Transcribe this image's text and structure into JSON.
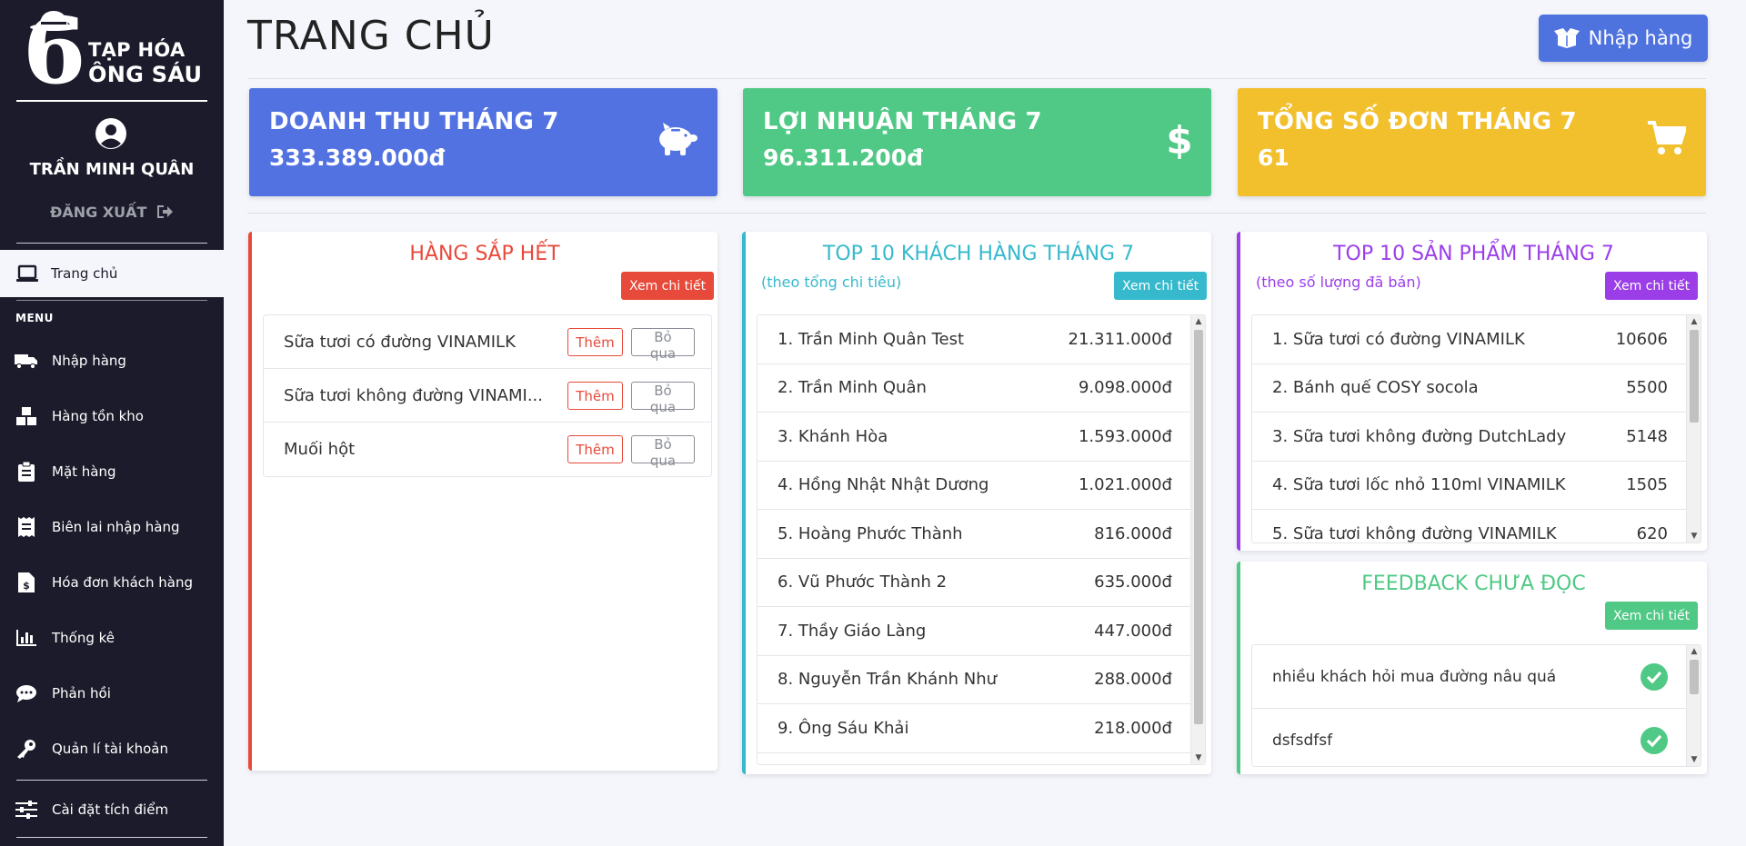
{
  "sidebar": {
    "logo": {
      "line1": "TẠP HÓA",
      "line2": "ÔNG SÁU"
    },
    "user_name": "TRẦN MINH QUÂN",
    "logout_label": "ĐĂNG XUẤT",
    "home_label": "Trang chủ",
    "menu_title": "MENU",
    "items": [
      {
        "label": "Nhập hàng",
        "icon": "truck-icon"
      },
      {
        "label": "Hàng tồn kho",
        "icon": "boxes-icon"
      },
      {
        "label": "Mặt hàng",
        "icon": "clipboard-icon"
      },
      {
        "label": "Biên lai nhập hàng",
        "icon": "receipt-icon"
      },
      {
        "label": "Hóa đơn khách hàng",
        "icon": "invoice-dollar-icon"
      },
      {
        "label": "Thống kê",
        "icon": "bar-chart-icon"
      },
      {
        "label": "Phản hồi",
        "icon": "comment-icon"
      },
      {
        "label": "Quản lí tài khoản",
        "icon": "key-icon"
      }
    ],
    "settings_label": "Cài đặt tích điểm"
  },
  "header": {
    "title": "TRANG CHỦ",
    "import_button": "Nhập hàng"
  },
  "stats": {
    "revenue": {
      "label": "DOANH THU THÁNG 7",
      "value": "333.389.000đ",
      "color": "#5272e2"
    },
    "profit": {
      "label": "LỢI NHUẬN THÁNG 7",
      "value": "96.311.200đ",
      "color": "#4fc985"
    },
    "orders": {
      "label": "TỔNG SỐ ĐƠN THÁNG 7",
      "value": "61",
      "color": "#f2bf2d"
    }
  },
  "low_stock": {
    "title": "HÀNG SẮP HẾT",
    "detail_button": "Xem chi tiết",
    "add_label": "Thêm",
    "skip_label": "Bỏ qua",
    "items": [
      "Sữa tươi có đường VINAMILK",
      "Sữa tươi không đường VINAMI...",
      "Muối hột"
    ]
  },
  "top_customers": {
    "title": "TOP 10 KHÁCH HÀNG THÁNG 7",
    "subtitle": "(theo tổng chi tiêu)",
    "detail_button": "Xem chi tiết",
    "rows": [
      {
        "name": "1. Trần Minh Quân Test",
        "value": "21.311.000đ"
      },
      {
        "name": "2. Trần Minh Quân",
        "value": "9.098.000đ"
      },
      {
        "name": "3. Khánh Hòa",
        "value": "1.593.000đ"
      },
      {
        "name": "4. Hồng Nhật Nhật Dương",
        "value": "1.021.000đ"
      },
      {
        "name": "5. Hoàng Phước Thành",
        "value": "816.000đ"
      },
      {
        "name": "6. Vũ Phước Thành 2",
        "value": "635.000đ"
      },
      {
        "name": "7. Thầy Giáo Làng",
        "value": "447.000đ"
      },
      {
        "name": "8. Nguyễn Trần Khánh Như",
        "value": "288.000đ"
      },
      {
        "name": "9. Ông Sáu Khải",
        "value": "218.000đ"
      }
    ]
  },
  "top_products": {
    "title": "TOP 10 SẢN PHẨM THÁNG 7",
    "subtitle": "(theo số lượng đã bán)",
    "detail_button": "Xem chi tiết",
    "rows": [
      {
        "name": "1. Sữa tươi có đường VINAMILK",
        "value": "10606"
      },
      {
        "name": "2. Bánh quế COSY socola",
        "value": "5500"
      },
      {
        "name": "3. Sữa tươi không đường DutchLady",
        "value": "5148"
      },
      {
        "name": "4. Sữa tươi lốc nhỏ 110ml VINAMILK",
        "value": "1505"
      },
      {
        "name": "5. Sữa tươi không đường VINAMILK",
        "value": "620"
      }
    ]
  },
  "feedback": {
    "title": "FEEDBACK CHƯA ĐỌC",
    "detail_button": "Xem chi tiết",
    "rows": [
      "nhiều khách hỏi mua đường nâu quá",
      "dsfsdfsf"
    ]
  },
  "colors": {
    "sidebar": "#1b1b2b",
    "danger": "#e74a3b",
    "info": "#36b9cc",
    "purple": "#9b3ee8",
    "success": "#4fc985",
    "primary": "#4e73df"
  }
}
